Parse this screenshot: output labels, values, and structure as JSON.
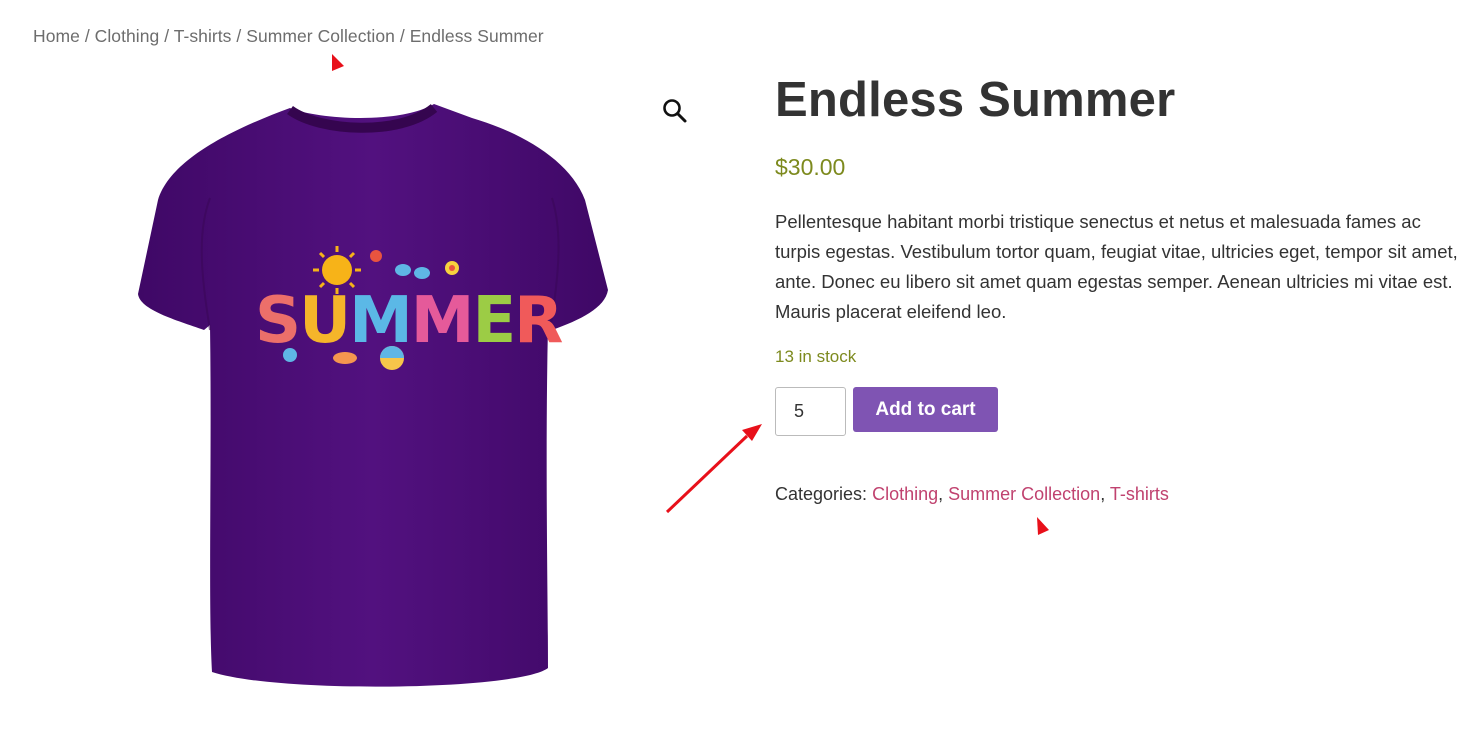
{
  "breadcrumb": {
    "items": [
      "Home",
      "Clothing",
      "T-shirts",
      "Summer Collection"
    ],
    "current": "Endless Summer",
    "separator": "/"
  },
  "gallery": {
    "icon": "zoom-search-icon",
    "shirt_text": "SUMMER",
    "shirt_color": "#4f0f7f"
  },
  "product": {
    "title": "Endless Summer",
    "price": "$30.00",
    "description": "Pellentesque habitant morbi tristique senectus et netus et malesuada fames ac turpis egestas. Vestibulum tortor quam, feugiat vitae, ultricies eget, tempor sit amet, ante. Donec eu libero sit amet quam egestas semper. Aenean ultricies mi vitae est. Mauris placerat eleifend leo.",
    "stock": "13 in stock",
    "quantity": "5",
    "add_to_cart": "Add to cart",
    "categories_label": "Categories:",
    "categories": [
      "Clothing",
      "Summer Collection",
      "T-shirts"
    ]
  },
  "colors": {
    "accent": "#7f54b3",
    "price": "#7d8a1e",
    "link": "#c0426f",
    "annotation": "#e8101a"
  }
}
